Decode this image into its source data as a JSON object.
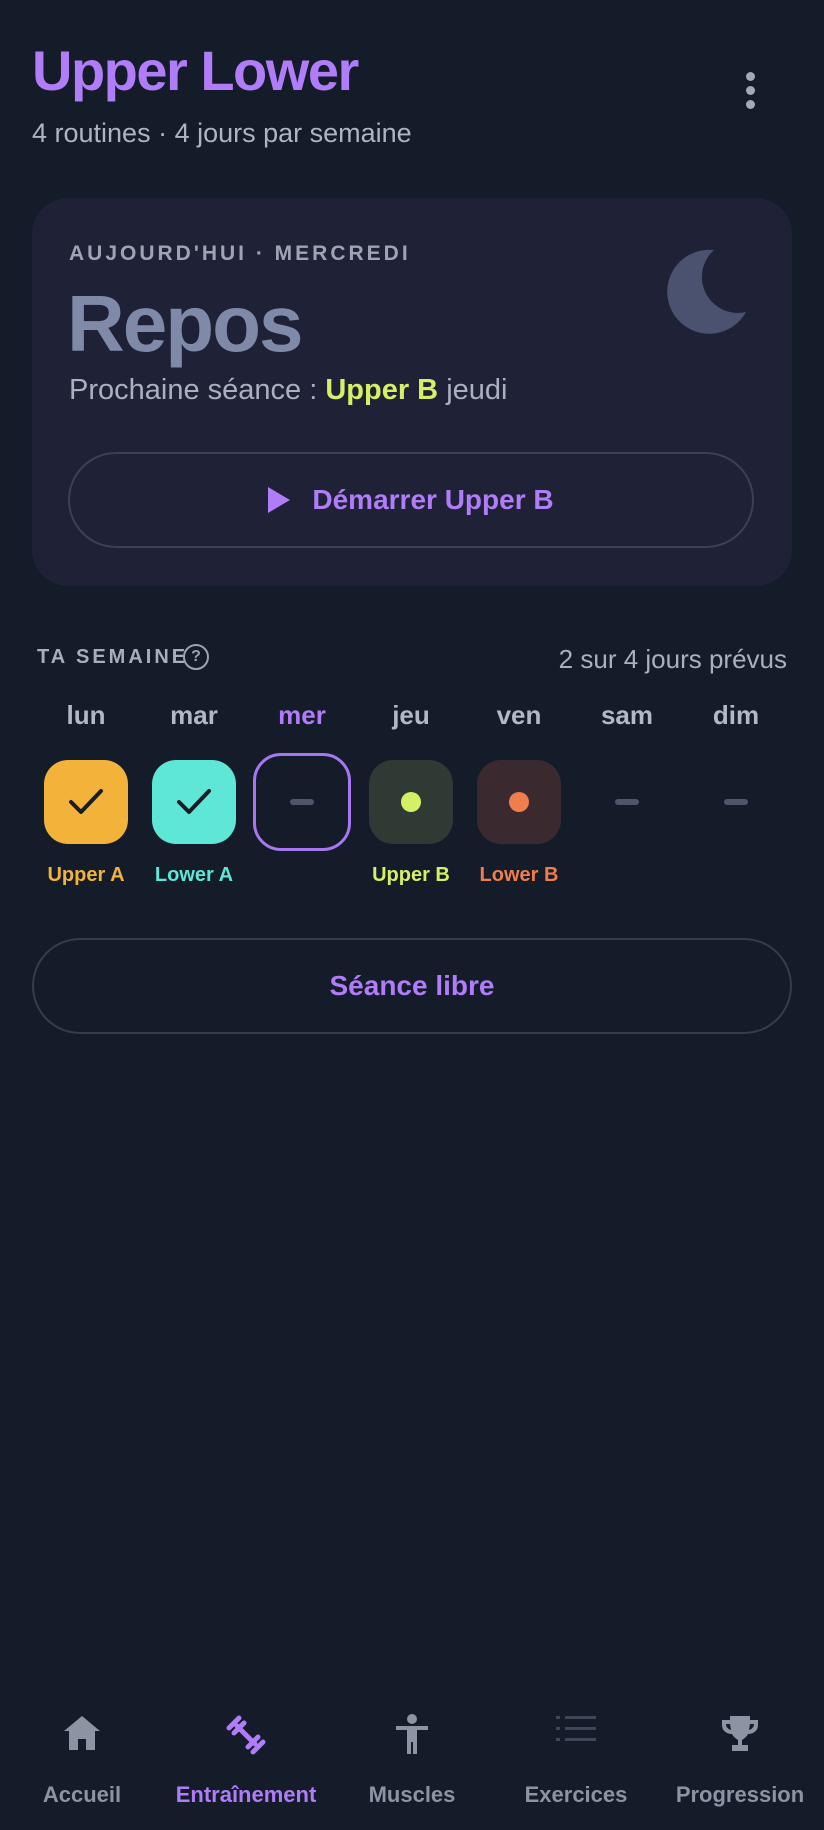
{
  "header": {
    "title": "Upper Lower",
    "subtitle": "4 routines · 4 jours par semaine",
    "menu_icon": "more-vertical-icon"
  },
  "today_card": {
    "label": "AUJOURD'HUI · MERCREDI",
    "status": "Repos",
    "next_prefix": "Prochaine séance : ",
    "next_routine": "Upper B",
    "next_day": "jeudi",
    "icon": "moon-icon",
    "start_button_label": "Démarrer Upper B"
  },
  "week": {
    "title": "TA SEMAINE",
    "count_text": "2 sur 4 jours prévus",
    "days": [
      {
        "name": "lun",
        "routine": "Upper A",
        "state": "done",
        "color": "#f3b33a"
      },
      {
        "name": "mar",
        "routine": "Lower A",
        "state": "done",
        "color": "#5ee6d6"
      },
      {
        "name": "mer",
        "routine": "",
        "state": "today-rest",
        "color": "#a678f0"
      },
      {
        "name": "jeu",
        "routine": "Upper B",
        "state": "planned",
        "color": "#d6f066"
      },
      {
        "name": "ven",
        "routine": "Lower B",
        "state": "planned",
        "color": "#f07d4c"
      },
      {
        "name": "sam",
        "routine": "",
        "state": "rest",
        "color": "#4f5669"
      },
      {
        "name": "dim",
        "routine": "",
        "state": "rest",
        "color": "#4f5669"
      }
    ]
  },
  "free_session_label": "Séance libre",
  "nav": [
    {
      "label": "Accueil",
      "icon": "home-icon",
      "active": false
    },
    {
      "label": "Entraînement",
      "icon": "dumbbell-icon",
      "active": true
    },
    {
      "label": "Muscles",
      "icon": "person-icon",
      "active": false
    },
    {
      "label": "Exercices",
      "icon": "list-icon",
      "active": false
    },
    {
      "label": "Progression",
      "icon": "trophy-icon",
      "active": false
    }
  ]
}
